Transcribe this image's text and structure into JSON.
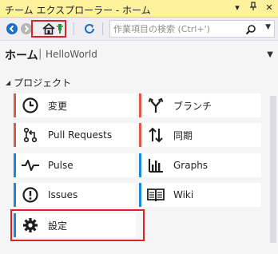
{
  "window": {
    "title": "チーム エクスプローラー - ホーム",
    "controls": [
      "▾",
      "ᴉ",
      "✕"
    ]
  },
  "toolbar": {
    "search_placeholder": "作業項目の検索 (Ctrl+')",
    "colors": {
      "back": "#1b6fc5",
      "forward": "#9b9b9b",
      "refresh": "#1b6fc5",
      "connect": "#2e8b3a"
    }
  },
  "header": {
    "title": "ホーム",
    "separator": "|",
    "project": "HelloWorld"
  },
  "section": {
    "title": "プロジェクト"
  },
  "tiles": [
    {
      "label": "変更",
      "icon": "clock-icon",
      "accent": "#e05a45"
    },
    {
      "label": "ブランチ",
      "icon": "branch-icon",
      "accent": "#e05a45"
    },
    {
      "label": "Pull Requests",
      "icon": "pull-request-icon",
      "accent": "#e05a45"
    },
    {
      "label": "同期",
      "icon": "sync-arrows-icon",
      "accent": "#e05a45"
    },
    {
      "label": "Pulse",
      "icon": "pulse-icon",
      "accent": "#1b8ad6"
    },
    {
      "label": "Graphs",
      "icon": "bar-graph-icon",
      "accent": "#1b8ad6"
    },
    {
      "label": "Issues",
      "icon": "issue-icon",
      "accent": "#1b8ad6"
    },
    {
      "label": "Wiki",
      "icon": "book-icon",
      "accent": "#1b8ad6"
    },
    {
      "label": "設定",
      "icon": "gear-icon",
      "accent": "#1b8ad6"
    }
  ],
  "highlight_color": "#e01f26"
}
